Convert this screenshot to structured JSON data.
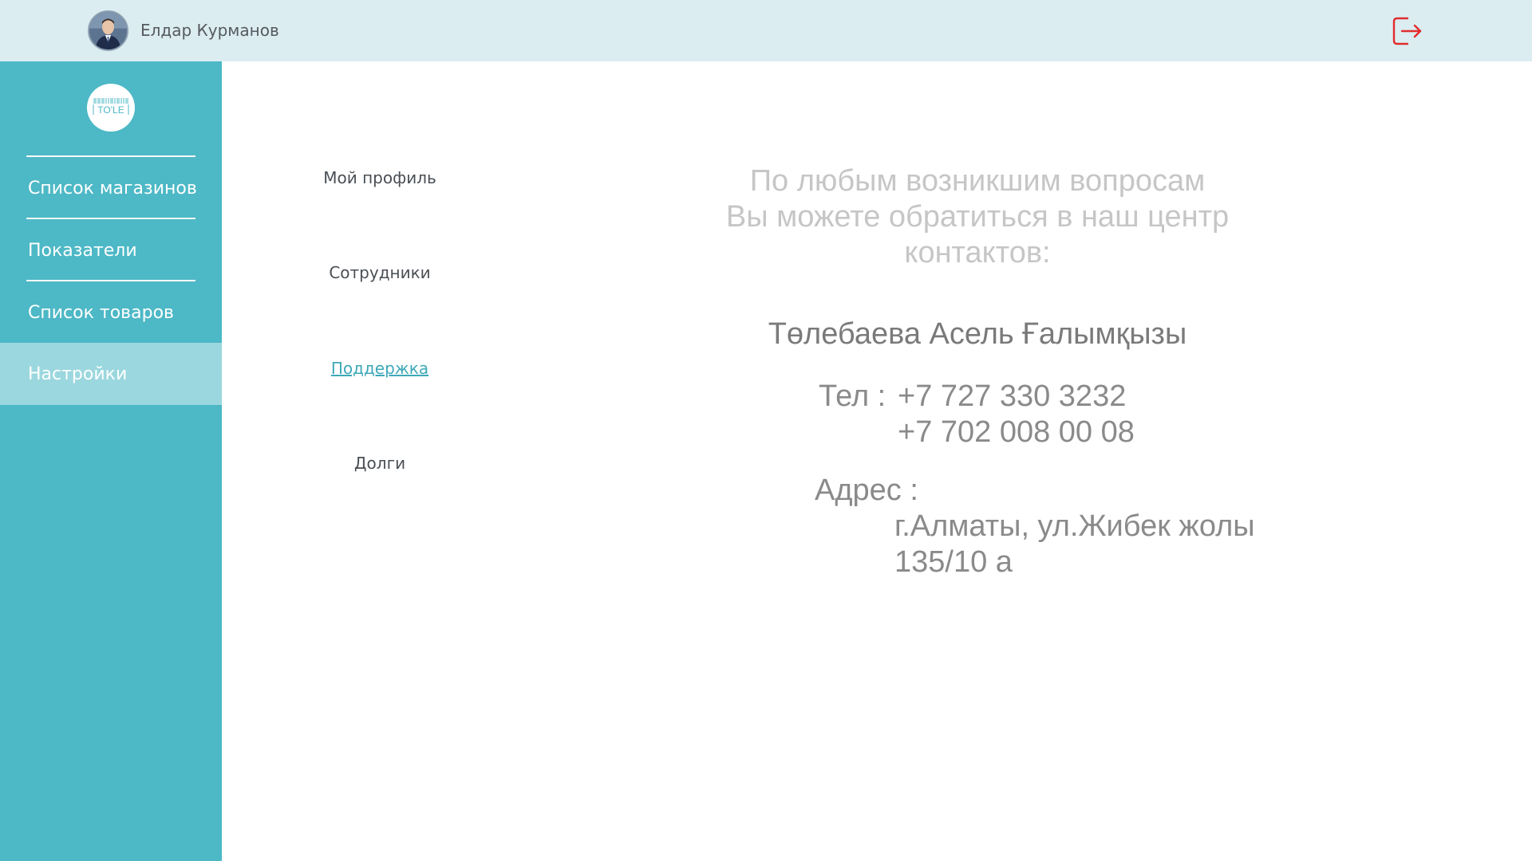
{
  "header": {
    "username": "Елдар Курманов",
    "logout_icon": "logout-icon",
    "logout_color": "#e02d2d"
  },
  "sidebar": {
    "logo_text": "TO'LE",
    "items": [
      {
        "label": "Список магазинов"
      },
      {
        "label": "Показатели"
      },
      {
        "label": "Список товаров"
      },
      {
        "label": "Настройки",
        "active": true
      }
    ],
    "bg_color": "#4db8c6",
    "active_color": "#9bd7de"
  },
  "settings_menu": {
    "items": [
      {
        "label": "Мой профиль"
      },
      {
        "label": "Сотрудники"
      },
      {
        "label": "Поддержка",
        "selected": true
      },
      {
        "label": "Долги"
      }
    ]
  },
  "support": {
    "intro_lines": [
      "По любым возникшим вопросам",
      "Вы можете обратиться в наш центр",
      "контактов:"
    ],
    "contact_name": "Төлебаева Асель Ғалымқызы",
    "phone_label": "Тел :",
    "phones": [
      "+7 727 330 3232",
      "+7 702 008 00 08"
    ],
    "address_label": "Адрес :",
    "address_lines": [
      "г.Алматы, ул.Жибек жолы",
      "135/10 а"
    ]
  }
}
